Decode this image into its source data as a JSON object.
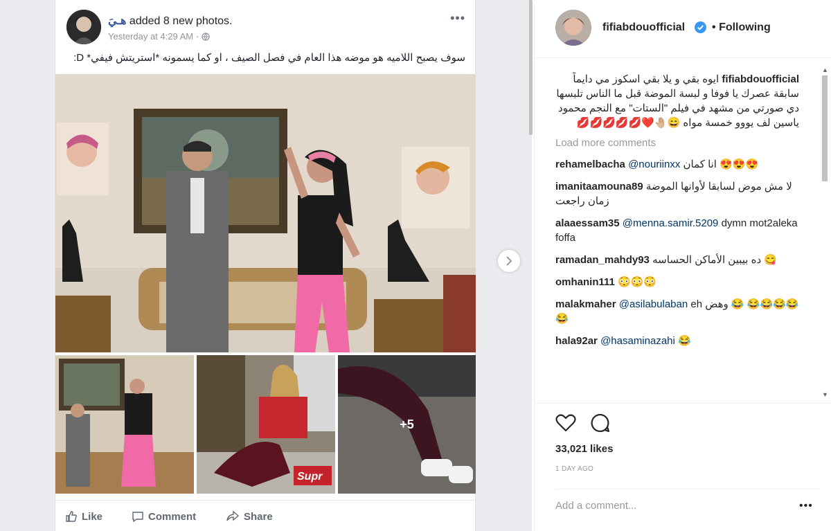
{
  "facebook": {
    "actor": "هـيَ",
    "action_text": "added 8 new photos.",
    "timestamp": "Yesterday at 4:29 AM",
    "separator": "·",
    "more_icon": "more-icon",
    "post_text": "سوف يصبح اللاميه هو موضه هذا العام في فصل الصيف ، او كما يسمونه *استريتش فيفي* D:",
    "extra_photos": "+5",
    "actions": {
      "like": "Like",
      "comment": "Comment",
      "share": "Share"
    }
  },
  "instagram": {
    "username": "fifiabdouofficial",
    "separator": "•",
    "follow_status": "Following",
    "caption_user": "fifiabdouofficial",
    "caption_text": "ايوه بقي و يلا بقي اسكوز مي دايماً سابقة عصرك يا فوفا و لبسة الموضة قبل ما الناس تلبسها دي صورتي من مشهد في فيلم \"الستات\" مع النجم محمود ياسين لف يووو خمسة مواه 😄🤚🏼❤️💋💋💋💋💋",
    "load_more": "Load more comments",
    "comments": [
      {
        "user": "rehamelbacha",
        "mention": "@nouriinxx",
        "text": "انا كمان 😍😍😍"
      },
      {
        "user": "imanitaamouna89",
        "mention": "",
        "text": "لا مش موض لسابقا لأوانها الموضة زمان راجعت"
      },
      {
        "user": "alaaessam35",
        "mention": "@menna.samir.5209",
        "text": "dymn mot2aleka foffa"
      },
      {
        "user": "ramadan_mahdy93",
        "mention": "",
        "text": "ده بيبين الأماكن الحساسه 😋"
      },
      {
        "user": "omhanin111",
        "mention": "",
        "text": "😳😳😳"
      },
      {
        "user": "malakmaher",
        "mention": "@asilabulaban",
        "text": "eh وهض 😂 😂😂😂😂😂"
      },
      {
        "user": "hala92ar",
        "mention": "@hasaminazahi",
        "text": "😂"
      }
    ],
    "likes": "33,021 likes",
    "date": "1 DAY AGO",
    "add_comment_placeholder": "Add a comment...",
    "options": "•••"
  },
  "colors": {
    "fb_background": "#e9ebee",
    "fb_link": "#365899",
    "ig_verified": "#3897f0",
    "ig_mention": "#003569"
  }
}
